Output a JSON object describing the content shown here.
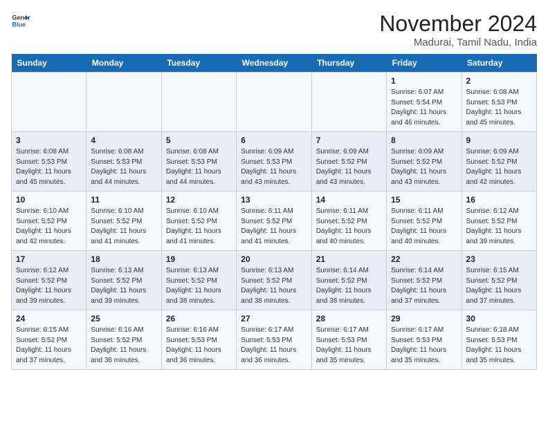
{
  "header": {
    "logo_line1": "General",
    "logo_line2": "Blue",
    "month_title": "November 2024",
    "location": "Madurai, Tamil Nadu, India"
  },
  "weekdays": [
    "Sunday",
    "Monday",
    "Tuesday",
    "Wednesday",
    "Thursday",
    "Friday",
    "Saturday"
  ],
  "weeks": [
    [
      {
        "day": "",
        "info": ""
      },
      {
        "day": "",
        "info": ""
      },
      {
        "day": "",
        "info": ""
      },
      {
        "day": "",
        "info": ""
      },
      {
        "day": "",
        "info": ""
      },
      {
        "day": "1",
        "info": "Sunrise: 6:07 AM\nSunset: 5:54 PM\nDaylight: 11 hours and 46 minutes."
      },
      {
        "day": "2",
        "info": "Sunrise: 6:08 AM\nSunset: 5:53 PM\nDaylight: 11 hours and 45 minutes."
      }
    ],
    [
      {
        "day": "3",
        "info": "Sunrise: 6:08 AM\nSunset: 5:53 PM\nDaylight: 11 hours and 45 minutes."
      },
      {
        "day": "4",
        "info": "Sunrise: 6:08 AM\nSunset: 5:53 PM\nDaylight: 11 hours and 44 minutes."
      },
      {
        "day": "5",
        "info": "Sunrise: 6:08 AM\nSunset: 5:53 PM\nDaylight: 11 hours and 44 minutes."
      },
      {
        "day": "6",
        "info": "Sunrise: 6:09 AM\nSunset: 5:53 PM\nDaylight: 11 hours and 43 minutes."
      },
      {
        "day": "7",
        "info": "Sunrise: 6:09 AM\nSunset: 5:52 PM\nDaylight: 11 hours and 43 minutes."
      },
      {
        "day": "8",
        "info": "Sunrise: 6:09 AM\nSunset: 5:52 PM\nDaylight: 11 hours and 43 minutes."
      },
      {
        "day": "9",
        "info": "Sunrise: 6:09 AM\nSunset: 5:52 PM\nDaylight: 11 hours and 42 minutes."
      }
    ],
    [
      {
        "day": "10",
        "info": "Sunrise: 6:10 AM\nSunset: 5:52 PM\nDaylight: 11 hours and 42 minutes."
      },
      {
        "day": "11",
        "info": "Sunrise: 6:10 AM\nSunset: 5:52 PM\nDaylight: 11 hours and 41 minutes."
      },
      {
        "day": "12",
        "info": "Sunrise: 6:10 AM\nSunset: 5:52 PM\nDaylight: 11 hours and 41 minutes."
      },
      {
        "day": "13",
        "info": "Sunrise: 6:11 AM\nSunset: 5:52 PM\nDaylight: 11 hours and 41 minutes."
      },
      {
        "day": "14",
        "info": "Sunrise: 6:11 AM\nSunset: 5:52 PM\nDaylight: 11 hours and 40 minutes."
      },
      {
        "day": "15",
        "info": "Sunrise: 6:11 AM\nSunset: 5:52 PM\nDaylight: 11 hours and 40 minutes."
      },
      {
        "day": "16",
        "info": "Sunrise: 6:12 AM\nSunset: 5:52 PM\nDaylight: 11 hours and 39 minutes."
      }
    ],
    [
      {
        "day": "17",
        "info": "Sunrise: 6:12 AM\nSunset: 5:52 PM\nDaylight: 11 hours and 39 minutes."
      },
      {
        "day": "18",
        "info": "Sunrise: 6:13 AM\nSunset: 5:52 PM\nDaylight: 11 hours and 39 minutes."
      },
      {
        "day": "19",
        "info": "Sunrise: 6:13 AM\nSunset: 5:52 PM\nDaylight: 11 hours and 38 minutes."
      },
      {
        "day": "20",
        "info": "Sunrise: 6:13 AM\nSunset: 5:52 PM\nDaylight: 11 hours and 38 minutes."
      },
      {
        "day": "21",
        "info": "Sunrise: 6:14 AM\nSunset: 5:52 PM\nDaylight: 11 hours and 38 minutes."
      },
      {
        "day": "22",
        "info": "Sunrise: 6:14 AM\nSunset: 5:52 PM\nDaylight: 11 hours and 37 minutes."
      },
      {
        "day": "23",
        "info": "Sunrise: 6:15 AM\nSunset: 5:52 PM\nDaylight: 11 hours and 37 minutes."
      }
    ],
    [
      {
        "day": "24",
        "info": "Sunrise: 6:15 AM\nSunset: 5:52 PM\nDaylight: 11 hours and 37 minutes."
      },
      {
        "day": "25",
        "info": "Sunrise: 6:16 AM\nSunset: 5:52 PM\nDaylight: 11 hours and 36 minutes."
      },
      {
        "day": "26",
        "info": "Sunrise: 6:16 AM\nSunset: 5:53 PM\nDaylight: 11 hours and 36 minutes."
      },
      {
        "day": "27",
        "info": "Sunrise: 6:17 AM\nSunset: 5:53 PM\nDaylight: 11 hours and 36 minutes."
      },
      {
        "day": "28",
        "info": "Sunrise: 6:17 AM\nSunset: 5:53 PM\nDaylight: 11 hours and 35 minutes."
      },
      {
        "day": "29",
        "info": "Sunrise: 6:17 AM\nSunset: 5:53 PM\nDaylight: 11 hours and 35 minutes."
      },
      {
        "day": "30",
        "info": "Sunrise: 6:18 AM\nSunset: 5:53 PM\nDaylight: 11 hours and 35 minutes."
      }
    ]
  ]
}
